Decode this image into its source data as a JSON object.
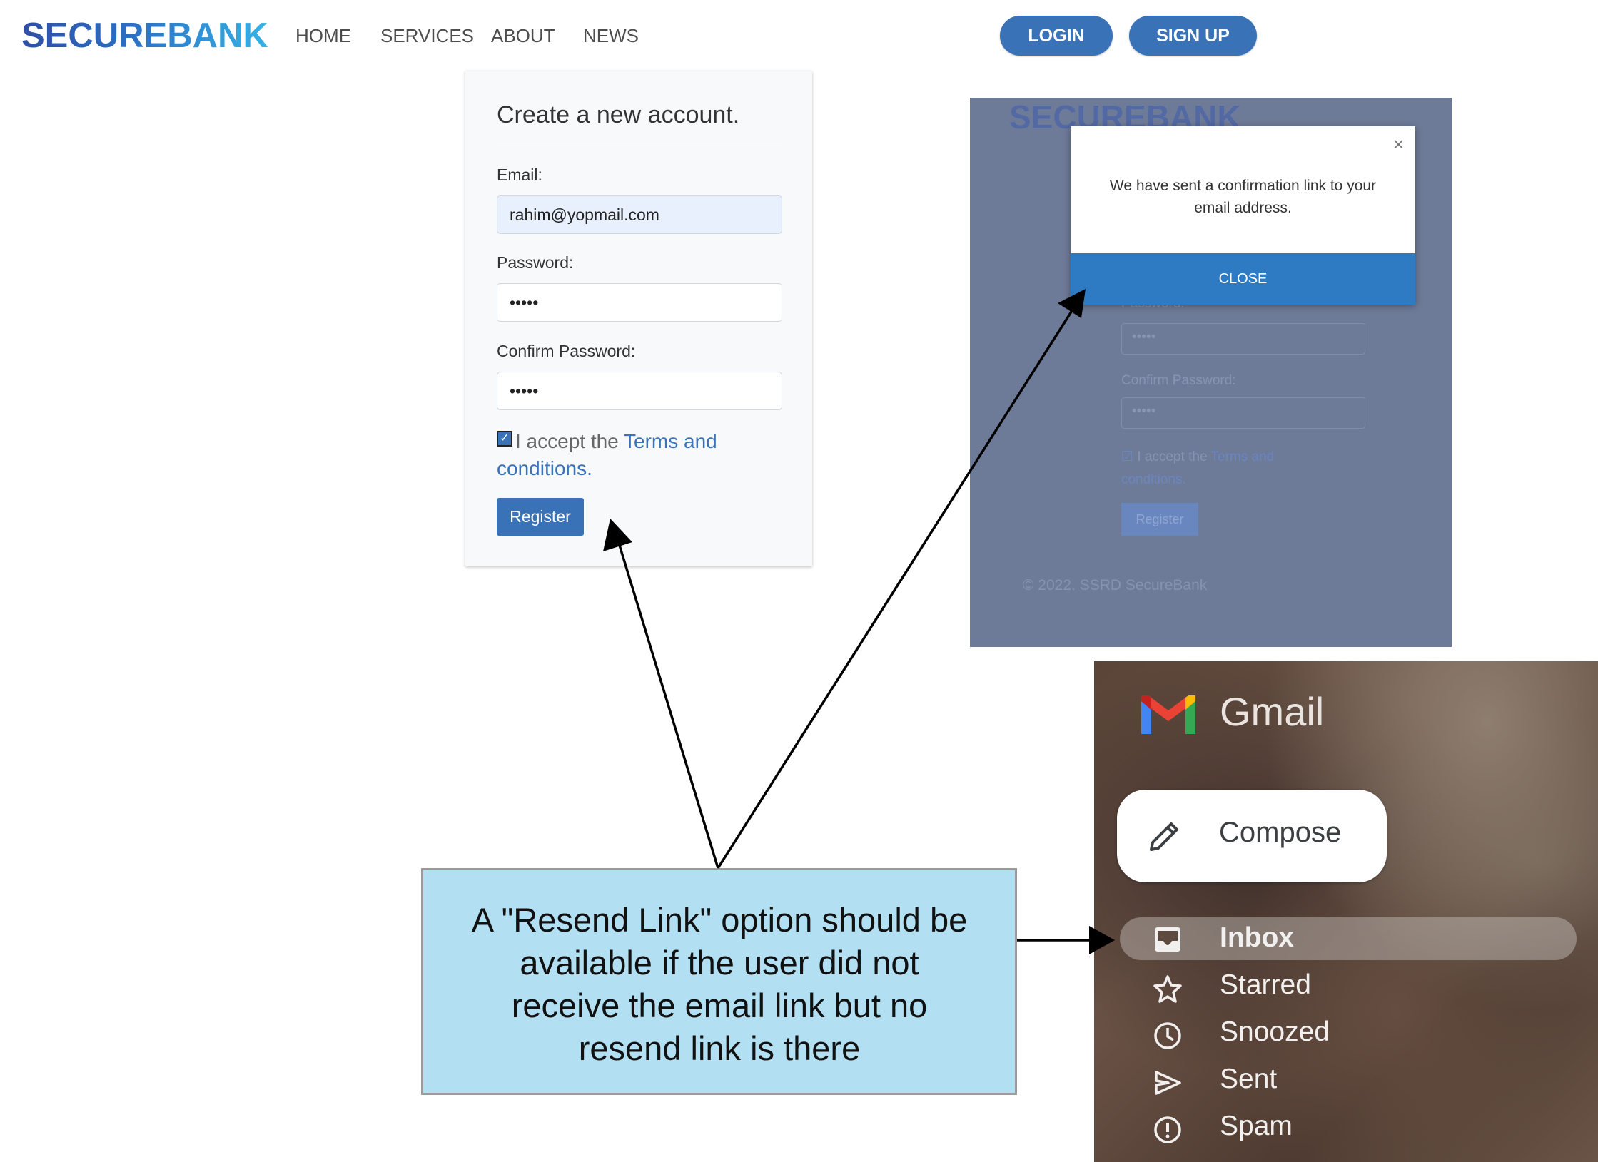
{
  "header": {
    "brand": "SECUREBANK",
    "nav": [
      "HOME",
      "SERVICES",
      "ABOUT",
      "NEWS"
    ],
    "login_label": "LOGIN",
    "signup_label": "SIGN UP"
  },
  "register_form": {
    "title": "Create a new account.",
    "email_label": "Email:",
    "email_value": "rahim@yopmail.com",
    "password_label": "Password:",
    "password_value": "•••••",
    "confirm_label": "Confirm Password:",
    "confirm_value": "•••••",
    "checkbox_checked": true,
    "accept_text": "I accept the ",
    "terms_link": "Terms and conditions",
    "accept_end": ".",
    "register_label": "Register"
  },
  "modal_screenshot": {
    "brand": "SECUREBANK",
    "close_x": "×",
    "message": "We have sent a confirmation link to your email address.",
    "close_label": "CLOSE",
    "bg_password_label": "Password:",
    "bg_password_value": "•••••",
    "bg_confirm_label": "Confirm Password:",
    "bg_confirm_value": "•••••",
    "bg_accept": "I accept the ",
    "bg_terms": "Terms and conditions.",
    "bg_register": "Register",
    "copyright": "© 2022. SSRD SecureBank"
  },
  "gmail": {
    "app_name": "Gmail",
    "compose_label": "Compose",
    "items": [
      {
        "label": "Inbox",
        "icon": "inbox-icon"
      },
      {
        "label": "Starred",
        "icon": "star-icon"
      },
      {
        "label": "Snoozed",
        "icon": "clock-icon"
      },
      {
        "label": "Sent",
        "icon": "send-icon"
      },
      {
        "label": "Spam",
        "icon": "spam-icon"
      }
    ]
  },
  "callout": {
    "text": "A \"Resend Link\" option should be available if the user did not receive the email link but no resend link is there"
  },
  "colors": {
    "accent": "#3a72b8",
    "callout_bg": "#b2dff2",
    "modal_close": "#2e7bc4"
  }
}
